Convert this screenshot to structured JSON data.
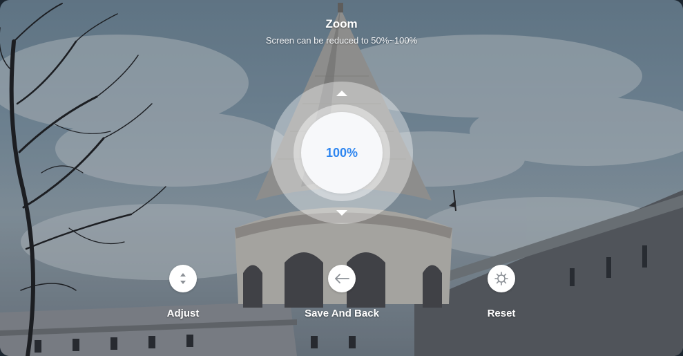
{
  "header": {
    "title": "Zoom",
    "subtitle": "Screen can be reduced to 50%~100%"
  },
  "zoom_dial": {
    "value_text": "100%",
    "zoom_percent": 100,
    "accent_color": "#2e86f0",
    "increase_icon": "triangle-up-icon",
    "decrease_icon": "triangle-down-icon"
  },
  "actions": [
    {
      "label": "Adjust",
      "icon": "up-down-arrows-icon"
    },
    {
      "label": "Save And Back",
      "icon": "arrow-left-icon"
    },
    {
      "label": "Reset",
      "icon": "gear-icon"
    }
  ]
}
